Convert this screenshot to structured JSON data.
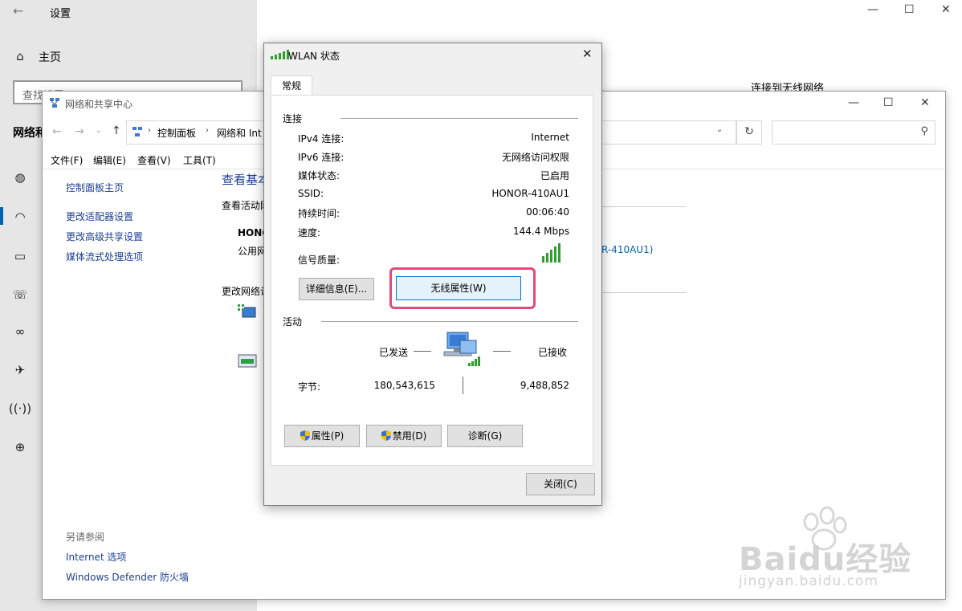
{
  "settings": {
    "title": "设置",
    "home": "主页",
    "search_placeholder": "查找设置",
    "section_partial": "网络和",
    "right_heading": "连接到无线网络"
  },
  "control_panel": {
    "title": "网络和共享中心",
    "breadcrumb": [
      "控制面板",
      "网络和 Int"
    ],
    "menu": [
      "文件(F)",
      "编辑(E)",
      "查看(V)",
      "工具(T)"
    ],
    "sidebar_links": [
      "控制面板主页",
      "更改适配器设置",
      "更改高级共享设置",
      "媒体流式处理选项"
    ],
    "heading_partial": "查看基本",
    "active_partial": "查看活动网",
    "network_name_partial": "HONC",
    "network_type_partial": "公用网",
    "change_partial": "更改网络设",
    "ssid_link_partial": "R-410AU1)",
    "see_also": "另请参阅",
    "see_also_links": [
      "Internet 选项",
      "Windows Defender 防火墙"
    ]
  },
  "dialog": {
    "title": "WLAN 状态",
    "tab": "常规",
    "connection_group": "连接",
    "rows": [
      {
        "label": "IPv4 连接:",
        "value": "Internet"
      },
      {
        "label": "IPv6 连接:",
        "value": "无网络访问权限"
      },
      {
        "label": "媒体状态:",
        "value": "已启用"
      },
      {
        "label": "SSID:",
        "value": "HONOR-410AU1"
      },
      {
        "label": "持续时间:",
        "value": "00:06:40"
      },
      {
        "label": "速度:",
        "value": "144.4 Mbps"
      }
    ],
    "signal_label": "信号质量:",
    "signal_bars": 5,
    "details_button": "详细信息(E)...",
    "wireless_props_button": "无线属性(W)",
    "activity_group": "活动",
    "sent_label": "已发送",
    "received_label": "已接收",
    "bytes_label": "字节:",
    "bytes_sent": "180,543,615",
    "bytes_received": "9,488,852",
    "properties_button": "属性(P)",
    "disable_button": "禁用(D)",
    "diagnose_button": "诊断(G)",
    "close_button": "关闭(C)"
  },
  "watermark": {
    "brand": "Baidu经验",
    "url": "jingyan.baidu.com"
  },
  "colors": {
    "highlight": "#e8467c",
    "link": "#1a3f8f",
    "signal": "#2e9e2e",
    "focus_border": "#0078d7"
  }
}
